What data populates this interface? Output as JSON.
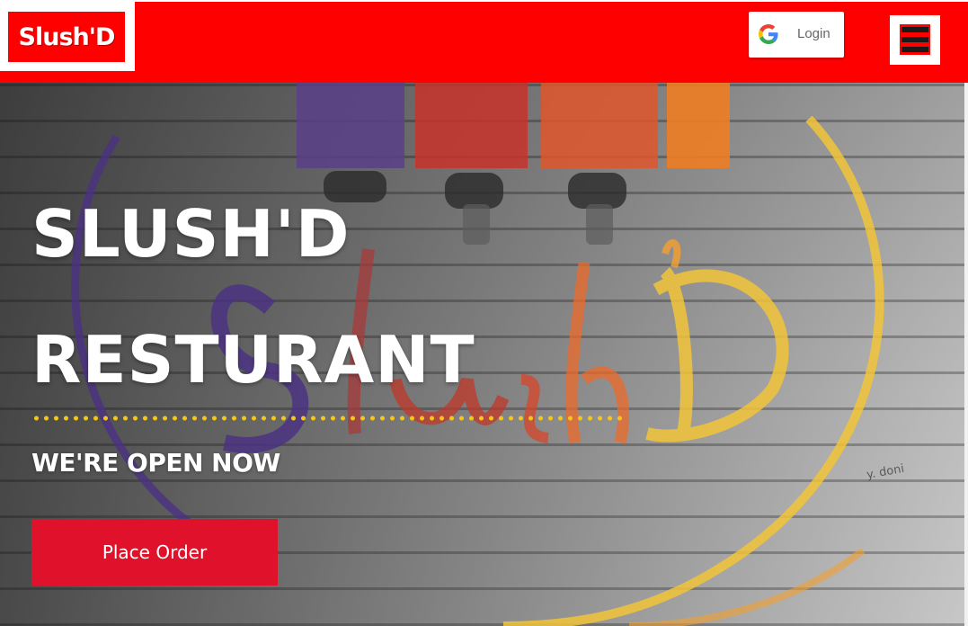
{
  "header": {
    "brand": "Slush'D",
    "login_label": "Login",
    "login_icon": "google-g-icon",
    "menu_icon": "hamburger-menu-icon",
    "bg_color": "#ff0000"
  },
  "hero": {
    "title_line1": "SLUSH'D",
    "title_line2": "RESTURANT",
    "subtitle": "WE'RE OPEN NOW",
    "cta_label": "Place Order",
    "cta_color": "#e0112b",
    "divider_color": "#f5c518"
  }
}
